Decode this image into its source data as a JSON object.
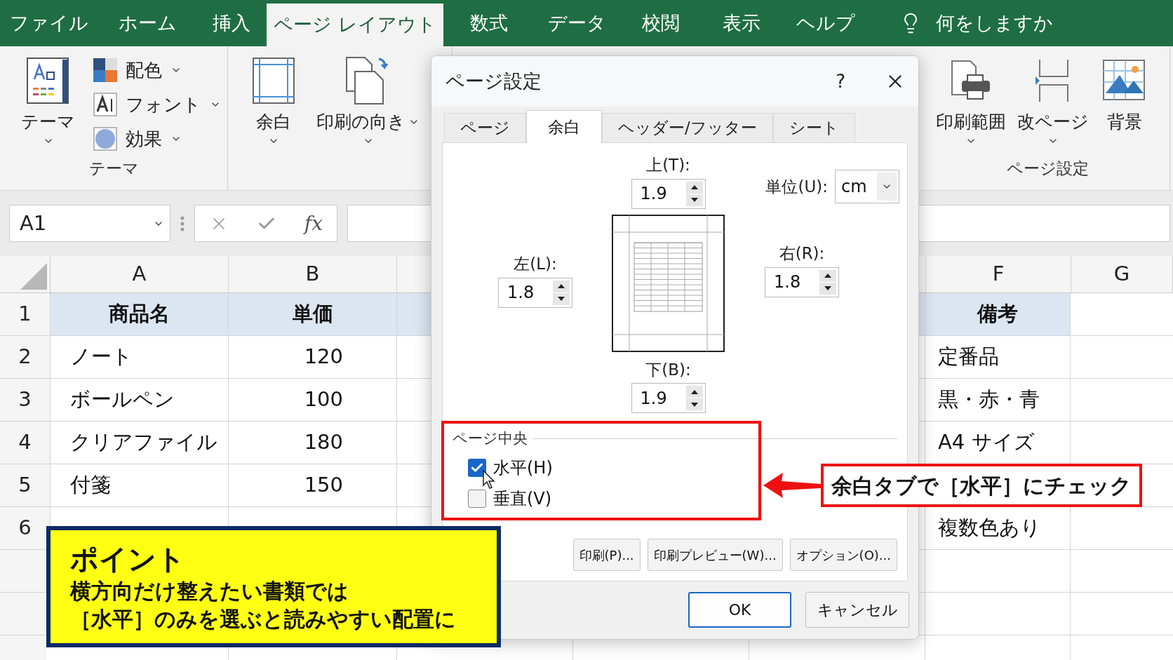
{
  "ribbon_tabs": [
    {
      "label": "ファイル",
      "selected": false
    },
    {
      "label": "ホーム",
      "selected": false
    },
    {
      "label": "挿入",
      "selected": false
    },
    {
      "label": "ページ レイアウト",
      "selected": true
    },
    {
      "label": "数式",
      "selected": false
    },
    {
      "label": "データ",
      "selected": false
    },
    {
      "label": "校閲",
      "selected": false
    },
    {
      "label": "表示",
      "selected": false
    },
    {
      "label": "ヘルプ",
      "selected": false
    }
  ],
  "tell_me": {
    "placeholder": "何をしますか"
  },
  "ribbon_groups": [
    {
      "label": "テーマ",
      "items": [
        {
          "kind": "large",
          "label": "テーマ",
          "dropdown": true,
          "side_arrow": false
        },
        {
          "kind": "small",
          "label": "配色",
          "dropdown": true
        },
        {
          "kind": "small",
          "label": "フォント",
          "dropdown": true
        },
        {
          "kind": "small",
          "label": "効果",
          "dropdown": true
        }
      ]
    },
    {
      "items": [
        {
          "kind": "large",
          "label": "余白",
          "dropdown": true,
          "side_arrow": false
        },
        {
          "kind": "large",
          "label": "印刷の向き",
          "dropdown": true,
          "side_arrow": true
        }
      ]
    },
    {
      "label": "ページ設定",
      "items": [
        {
          "kind": "large",
          "label": "印刷範囲",
          "dropdown": true,
          "side_arrow": false
        },
        {
          "kind": "large",
          "label": "改ページ",
          "dropdown": true,
          "side_arrow": false
        },
        {
          "kind": "large",
          "label": "背景",
          "dropdown": false,
          "side_arrow": false
        }
      ]
    }
  ],
  "formula_bar": {
    "name_box": "A1",
    "function_label": "fx"
  },
  "sheet": {
    "columns": [
      "A",
      "B",
      "F",
      "G"
    ],
    "rows": [
      {
        "number": "1",
        "header": true,
        "cells": [
          "商品名",
          "単価",
          "備考"
        ]
      },
      {
        "number": "2",
        "header": false,
        "cells": [
          "ノート",
          "120",
          "定番品"
        ]
      },
      {
        "number": "3",
        "header": false,
        "cells": [
          "ボールペン",
          "100",
          "黒・赤・青"
        ]
      },
      {
        "number": "4",
        "header": false,
        "cells": [
          "クリアファイル",
          "180",
          "A4 サイズ"
        ]
      },
      {
        "number": "5",
        "header": false,
        "cells": [
          "付箋",
          "150",
          null
        ]
      },
      {
        "number": "6",
        "header": false,
        "cells": [
          null,
          null,
          "複数色あり"
        ]
      }
    ]
  },
  "dialog": {
    "title": "ページ設定",
    "help": "?",
    "tabs": [
      {
        "label": "ページ",
        "selected": false
      },
      {
        "label": "余白",
        "selected": true
      },
      {
        "label": "ヘッダー/フッター",
        "selected": false
      },
      {
        "label": "シート",
        "selected": false
      }
    ],
    "margins": [
      {
        "kind": "top",
        "label": "上(T):",
        "value": "1.9"
      },
      {
        "kind": "left",
        "label": "左(L):",
        "value": "1.8"
      },
      {
        "kind": "right",
        "label": "右(R):",
        "value": "1.8"
      },
      {
        "kind": "bottom",
        "label": "下(B):",
        "value": "1.9"
      }
    ],
    "unit": {
      "label": "単位(U):",
      "value": "cm"
    },
    "center_group": {
      "label": "ページ中央",
      "options": [
        {
          "label": "水平(H)",
          "checked": true
        },
        {
          "label": "垂直(V)",
          "checked": false
        }
      ]
    },
    "buttons": [
      "印刷(P)...",
      "印刷プレビュー(W)...",
      "オプション(O)..."
    ],
    "footer_buttons": [
      {
        "label": "OK",
        "default": true
      },
      {
        "label": "キャンセル",
        "default": false
      }
    ]
  },
  "callout": {
    "text": "余白タブで［水平］にチェック"
  },
  "point_box": {
    "title": "ポイント",
    "lines": [
      "横方向だけ整えたい書類では",
      "［水平］のみを選ぶと読みやすい配置に"
    ]
  }
}
